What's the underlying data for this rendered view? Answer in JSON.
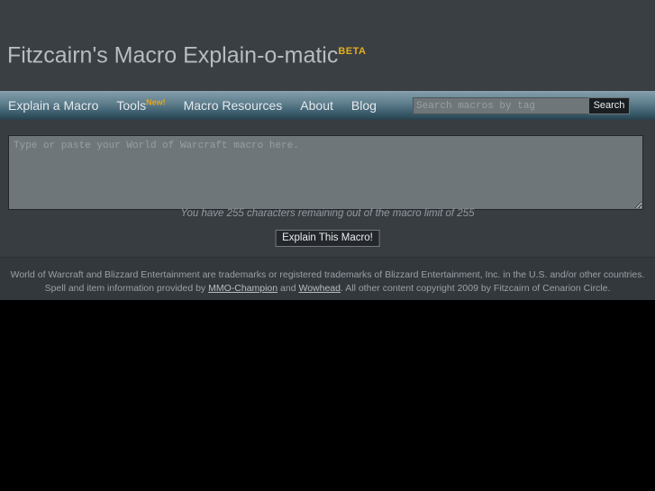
{
  "header": {
    "title": "Fitzcairn's Macro Explain-o-matic",
    "badge": "BETA"
  },
  "nav": {
    "items": [
      {
        "label": "Explain a Macro",
        "badge": ""
      },
      {
        "label": "Tools",
        "badge": "New!"
      },
      {
        "label": "Macro Resources",
        "badge": ""
      },
      {
        "label": "About",
        "badge": ""
      },
      {
        "label": "Blog",
        "badge": ""
      }
    ],
    "search": {
      "value": "",
      "placeholder": "Search macros by tag",
      "button_label": "Search"
    }
  },
  "main": {
    "macro_input": {
      "value": "",
      "placeholder": "Type or paste your World of Warcraft macro here."
    },
    "char_counter": "You have 255 characters remaining out of the macro limit of 255",
    "submit_label": "Explain This Macro!"
  },
  "footer": {
    "line_part_1": "World of Warcraft and Blizzard Entertainment are trademarks or registered trademarks of Blizzard Entertainment, Inc. in the U.S. and/or other countries. Spell and item information provided by ",
    "link_1": "MMO-Champion",
    "line_part_2": " and ",
    "link_2": "Wowhead",
    "line_part_3": ". All other content copyright 2009 by Fitzcairn of Cenarion Circle."
  },
  "colors": {
    "page_background": "#383d42",
    "header_background": "#3a3f44",
    "nav_gradient_top": "#8fa6b2",
    "nav_gradient_bottom": "#28404c",
    "accent_gold": "#e3ae1c",
    "input_background": "#6e7679",
    "footer_background": "#33383d",
    "outside_background": "#000000"
  }
}
